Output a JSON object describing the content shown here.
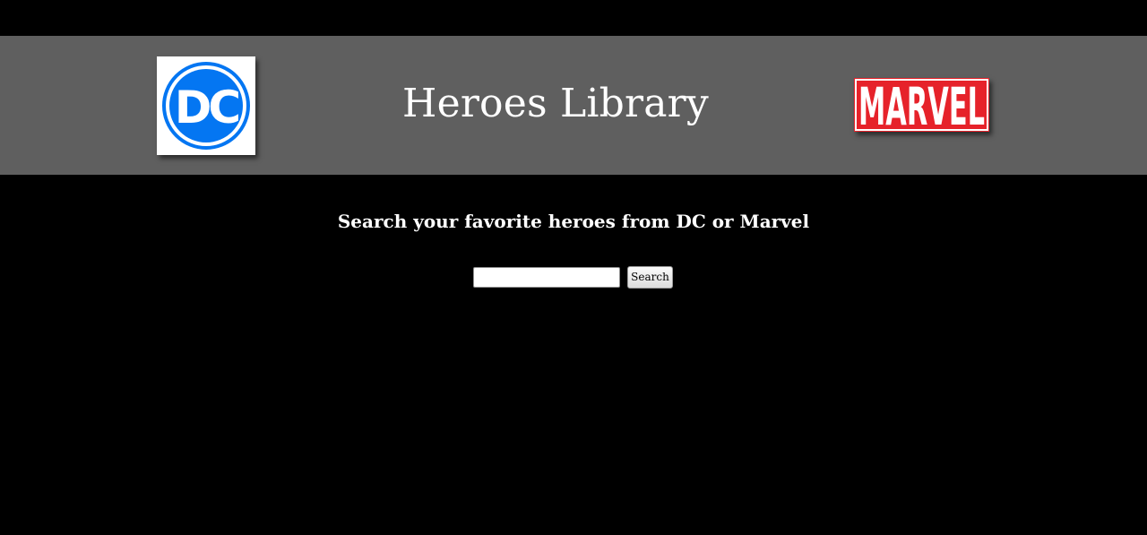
{
  "header": {
    "title": "Heroes Library",
    "left_logo": {
      "icon": "dc-logo",
      "text": "DC",
      "color": "#0476f2"
    },
    "right_logo": {
      "icon": "marvel-logo",
      "text": "MARVEL",
      "color": "#e6222a"
    }
  },
  "main": {
    "tagline": "Search your favorite heroes from DC or Marvel",
    "search": {
      "value": "",
      "placeholder": "",
      "button_label": "Search"
    }
  },
  "colors": {
    "page_background": "#000000",
    "banner_background": "#5f5f5f",
    "text": "#ffffff"
  }
}
